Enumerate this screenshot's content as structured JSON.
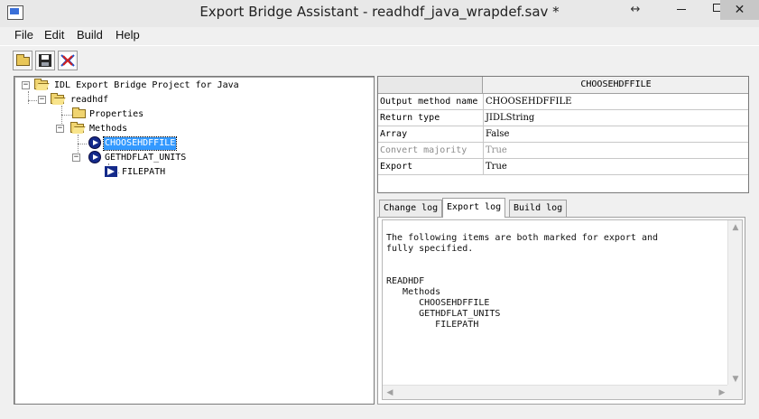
{
  "window": {
    "title": "Export Bridge Assistant - readhdf_java_wrapdef.sav *",
    "resize_glyph": "↔",
    "minimize_glyph": "–",
    "maximize_glyph": "□",
    "close_glyph": "✕"
  },
  "menu": [
    "File",
    "Edit",
    "Build",
    "Help"
  ],
  "toolbar": {
    "icons": [
      "open-folder-icon",
      "save-disk-icon",
      "build-wizard-icon"
    ]
  },
  "tree": {
    "root": "IDL Export Bridge Project for Java",
    "object": "readhdf",
    "properties": "Properties",
    "methods": "Methods",
    "method_1": "CHOOSEHDFFILE",
    "method_2": "GETHDFLAT_UNITS",
    "param_1": "FILEPATH",
    "expand_minus": "−",
    "expand_plus": "+"
  },
  "property_grid": {
    "header": "CHOOSEHDFFILE",
    "rows": [
      {
        "name": "Output method name",
        "value": "CHOOSEHDFFILE"
      },
      {
        "name": "Return type",
        "value": "JIDLString"
      },
      {
        "name": "Array",
        "value": "False"
      },
      {
        "name": "Convert majority",
        "value": "True"
      },
      {
        "name": "Export",
        "value": "True"
      }
    ]
  },
  "tabs": [
    "Change log",
    "Export log",
    "Build log"
  ],
  "active_tab": "Export log",
  "log": {
    "text": "The following items are both marked for export and\nfully specified.\n\n\nREADHDF\n   Methods\n      CHOOSEHDFFILE\n      GETHDFLAT_UNITS\n         FILEPATH"
  },
  "colors": {
    "selection": "#3399ff",
    "method_icon": "#142a8a",
    "folder": "#f0d470"
  }
}
